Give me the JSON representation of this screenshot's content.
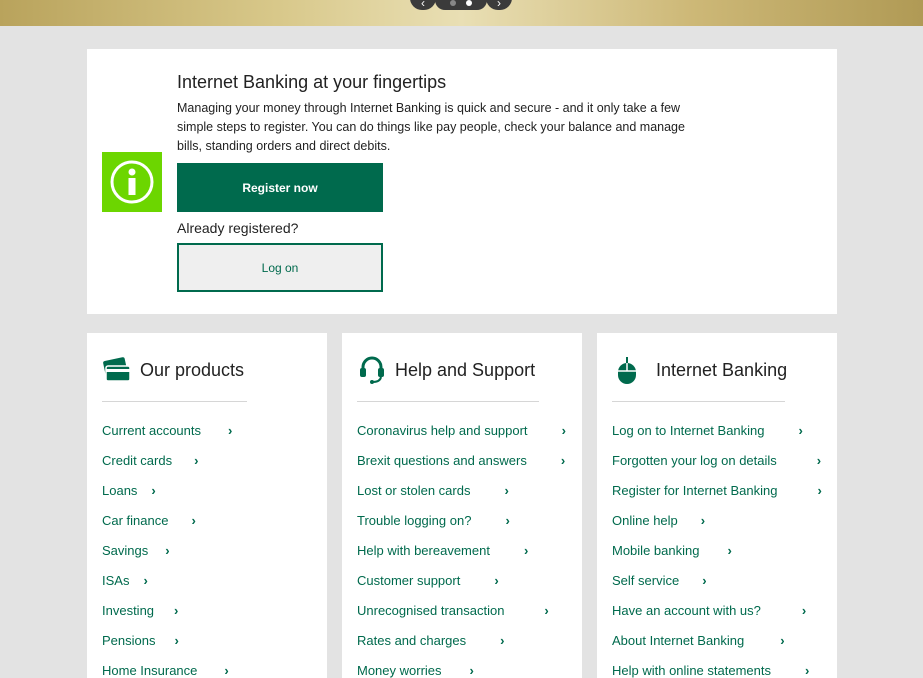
{
  "colors": {
    "brand_green": "#006a4d",
    "info_green": "#6cd600",
    "page_bg": "#e3e3e3"
  },
  "carousel": {
    "prev_icon": "chevron-left-icon",
    "next_icon": "chevron-right-icon",
    "prev_label": "‹",
    "next_label": "›"
  },
  "ib_panel": {
    "icon": "info-icon",
    "title": "Internet Banking at your fingertips",
    "description": "Managing your money through Internet Banking is quick and secure - and it only take a few simple steps to register. You can do things like pay people, check your balance and manage bills, standing orders and direct debits.",
    "register_label": "Register now",
    "already_label": "Already registered?",
    "logon_label": "Log on"
  },
  "cards": [
    {
      "title": "Our products",
      "icon": "credit-card-icon",
      "links": [
        "Current accounts",
        "Credit cards",
        "Loans",
        "Car finance",
        "Savings",
        "ISAs",
        "Investing",
        "Pensions",
        "Home Insurance"
      ]
    },
    {
      "title": "Help and Support",
      "icon": "headset-icon",
      "links": [
        "Coronavirus help and support",
        "Brexit questions and answers",
        "Lost or stolen cards",
        "Trouble logging on?",
        "Help with bereavement",
        "Customer support",
        "Unrecognised transaction",
        "Rates and charges",
        "Money worries"
      ]
    },
    {
      "title": "Internet Banking",
      "icon": "mouse-icon",
      "links": [
        "Log on to Internet Banking",
        "Forgotten your log on details",
        "Register for Internet Banking",
        "Online help",
        "Mobile banking",
        "Self service",
        "Have an account with us?",
        "About Internet Banking",
        "Help with online statements"
      ]
    }
  ],
  "chevron_glyph": "›"
}
